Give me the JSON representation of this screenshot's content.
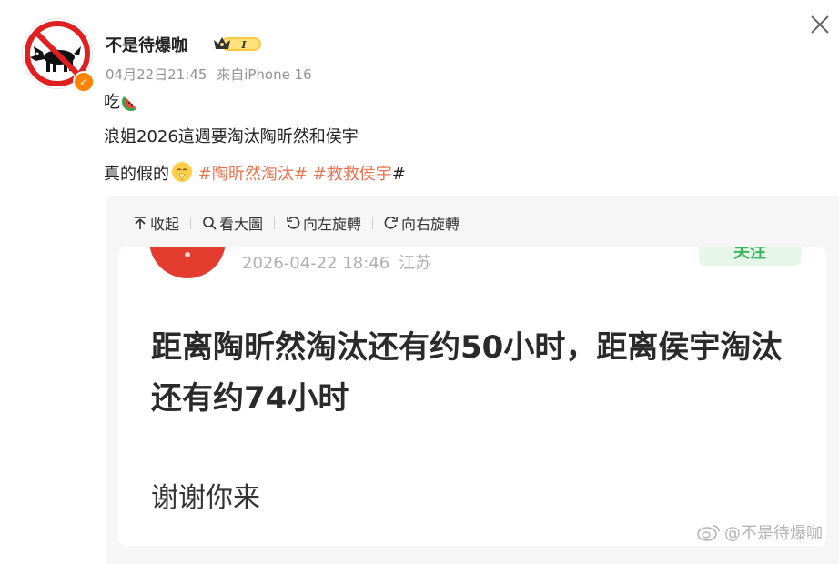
{
  "post": {
    "username": "不是待爆咖",
    "level_badge": "I",
    "timestamp": "04月22日21:45",
    "source": "來自iPhone 16",
    "line1": "吃",
    "line2": "浪姐2026這週要淘汰陶昕然和侯宇",
    "line3_prefix": "真的假的",
    "tag1": "#陶昕然淘汰#",
    "tag2": "#救救侯宇",
    "tag2_suffix": "#"
  },
  "toolbar": {
    "collapse": "收起",
    "view_large": "看大圖",
    "rotate_left": "向左旋轉",
    "rotate_right": "向右旋轉"
  },
  "image": {
    "meta_time": "2026-04-22 18:46",
    "meta_location": "江苏",
    "follow_button": "关注",
    "main_text": "距离陶昕然淘汰还有约50小时，距离侯宇淘汰还有约74小时",
    "thanks_text": "谢谢你来",
    "watermark": "@不是待爆咖"
  },
  "colors": {
    "tag": "#eb7350",
    "verified": "#ff8200",
    "meta": "#939393"
  },
  "icons": [
    "dog-avatar",
    "verified-icon",
    "level-crown-icon",
    "close-icon",
    "watermelon-emoji",
    "pray-emoji",
    "collapse-icon",
    "search-icon",
    "rotate-left-icon",
    "rotate-right-icon",
    "weibo-logo"
  ]
}
